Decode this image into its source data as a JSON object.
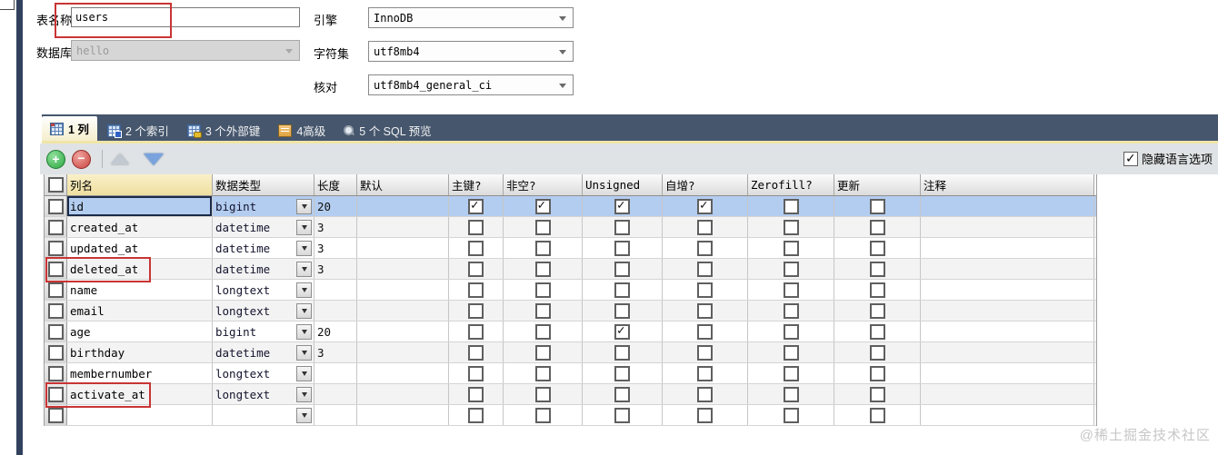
{
  "form": {
    "table_name_label": "表名称",
    "table_name_value": "users",
    "database_label": "数据库",
    "database_value": "hello",
    "engine_label": "引擎",
    "engine_value": "InnoDB",
    "charset_label": "字符集",
    "charset_value": "utf8mb4",
    "collation_label": "核对",
    "collation_value": "utf8mb4_general_ci"
  },
  "tabs": [
    {
      "label": "1 列",
      "icon": "columns",
      "active": true
    },
    {
      "label": "2 个索引",
      "icon": "indexes",
      "active": false
    },
    {
      "label": "3 个外部键",
      "icon": "foreign",
      "active": false
    },
    {
      "label": "4高级",
      "icon": "advanced",
      "active": false
    },
    {
      "label": "5 个 SQL 预览",
      "icon": "sql",
      "active": false
    }
  ],
  "toolbar": {
    "hide_language_label": "隐藏语言选项",
    "hide_language_checked": true
  },
  "grid": {
    "headers": [
      "列名",
      "数据类型",
      "长度",
      "默认",
      "主键?",
      "非空?",
      "Unsigned",
      "自增?",
      "Zerofill?",
      "更新",
      "注释"
    ],
    "rows": [
      {
        "name": "id",
        "type": "bigint",
        "length": "20",
        "default": "",
        "pk": true,
        "nn": true,
        "un": true,
        "ai": true,
        "zf": false,
        "up": false,
        "comment": "",
        "selected": true
      },
      {
        "name": "created_at",
        "type": "datetime",
        "length": "3",
        "default": "",
        "pk": false,
        "nn": false,
        "un": false,
        "ai": false,
        "zf": false,
        "up": false,
        "comment": ""
      },
      {
        "name": "updated_at",
        "type": "datetime",
        "length": "3",
        "default": "",
        "pk": false,
        "nn": false,
        "un": false,
        "ai": false,
        "zf": false,
        "up": false,
        "comment": ""
      },
      {
        "name": "deleted_at",
        "type": "datetime",
        "length": "3",
        "default": "",
        "pk": false,
        "nn": false,
        "un": false,
        "ai": false,
        "zf": false,
        "up": false,
        "comment": "",
        "annotated": true
      },
      {
        "name": "name",
        "type": "longtext",
        "length": "",
        "default": "",
        "pk": false,
        "nn": false,
        "un": false,
        "ai": false,
        "zf": false,
        "up": false,
        "comment": ""
      },
      {
        "name": "email",
        "type": "longtext",
        "length": "",
        "default": "",
        "pk": false,
        "nn": false,
        "un": false,
        "ai": false,
        "zf": false,
        "up": false,
        "comment": ""
      },
      {
        "name": "age",
        "type": "bigint",
        "length": "20",
        "default": "",
        "pk": false,
        "nn": false,
        "un": true,
        "ai": false,
        "zf": false,
        "up": false,
        "comment": ""
      },
      {
        "name": "birthday",
        "type": "datetime",
        "length": "3",
        "default": "",
        "pk": false,
        "nn": false,
        "un": false,
        "ai": false,
        "zf": false,
        "up": false,
        "comment": ""
      },
      {
        "name": "membernumber",
        "type": "longtext",
        "length": "",
        "default": "",
        "pk": false,
        "nn": false,
        "un": false,
        "ai": false,
        "zf": false,
        "up": false,
        "comment": ""
      },
      {
        "name": "activate_at",
        "type": "longtext",
        "length": "",
        "default": "",
        "pk": false,
        "nn": false,
        "un": false,
        "ai": false,
        "zf": false,
        "up": false,
        "comment": "",
        "annotated": true
      },
      {
        "name": "",
        "type": "",
        "length": "",
        "default": "",
        "pk": false,
        "nn": false,
        "un": false,
        "ai": false,
        "zf": false,
        "up": false,
        "comment": "",
        "empty": true
      }
    ]
  },
  "watermark": "@稀土掘金技术社区",
  "colors": {
    "tabbar_navy": "#45566d",
    "selection_blue": "#b3cdf0",
    "annotation_red": "#c93434",
    "header_highlight": "#f3e7ae",
    "toolbar_gray": "#e0e3e5"
  }
}
